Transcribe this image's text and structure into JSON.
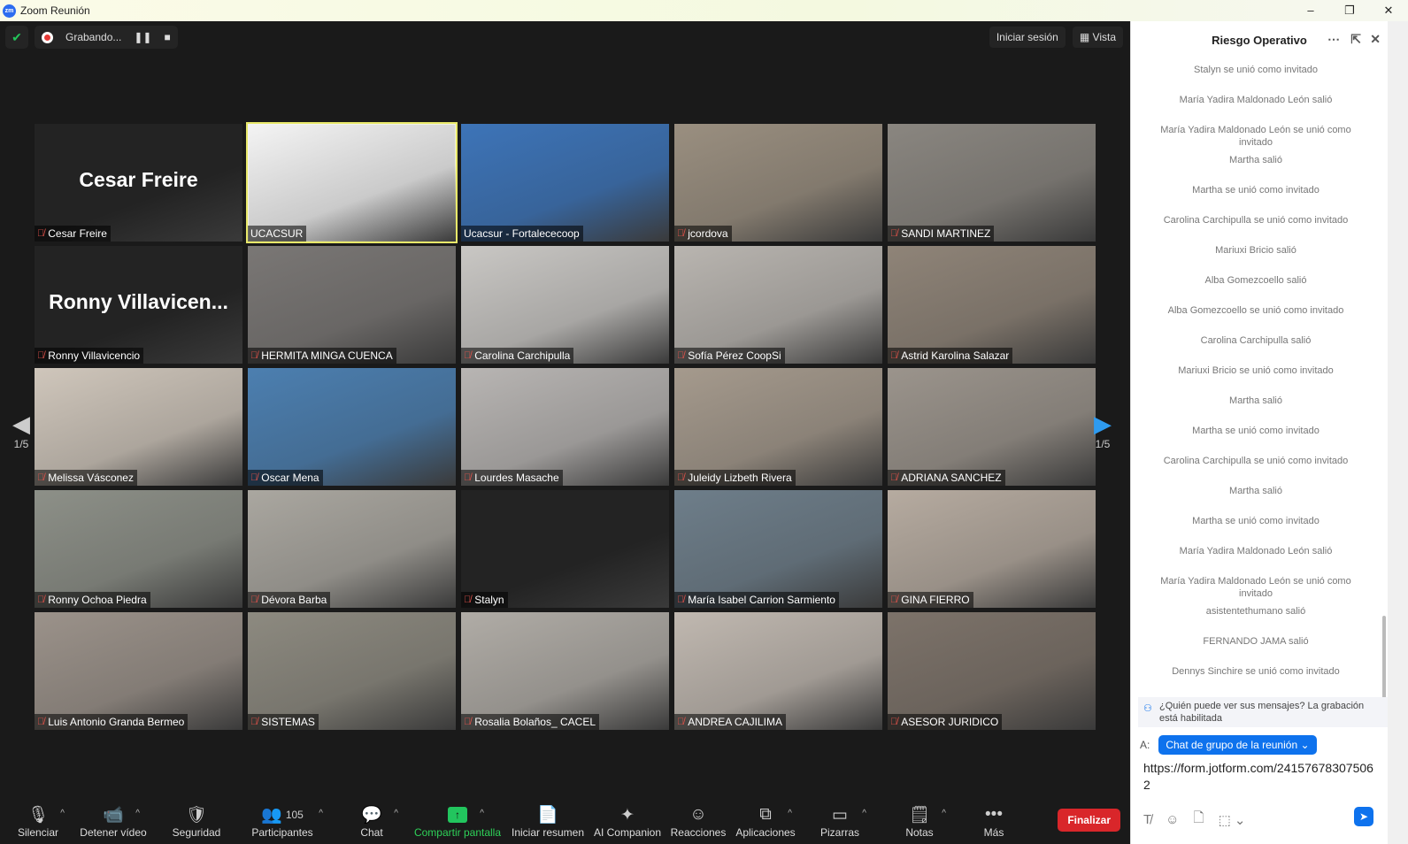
{
  "window": {
    "title": "Zoom Reunión",
    "logo": "zm",
    "controls": [
      "–",
      "❐",
      "✕"
    ]
  },
  "topbar": {
    "recording_label": "Grabando...",
    "signin": "Iniciar sesión",
    "view": "Vista"
  },
  "pager": {
    "page": "1/5"
  },
  "tiles": [
    {
      "name": "Cesar Freire",
      "big": "Cesar Freire",
      "bg": "#232323"
    },
    {
      "name": "UCACSUR",
      "bg": "#f4f4f4",
      "active": true
    },
    {
      "name": "Ucacsur - Fortalececoop",
      "bg": "#3d74b8",
      "muted": false
    },
    {
      "name": "jcordova",
      "bg": "#9a8f80"
    },
    {
      "name": "SANDI MARTINEZ",
      "bg": "#8a8680"
    },
    {
      "name": "Ronny Villavicencio",
      "big": "Ronny  Villavicen...",
      "bg": "#232323"
    },
    {
      "name": "HERMITA MINGA CUENCA",
      "bg": "#7a7775"
    },
    {
      "name": "Carolina Carchipulla",
      "bg": "#c9c7c4"
    },
    {
      "name": "Sofía Pérez CoopSi",
      "bg": "#b9b5b0"
    },
    {
      "name": "Astrid Karolina Salazar",
      "bg": "#8f8478"
    },
    {
      "name": "Melissa Vásconez",
      "bg": "#cfc6bb"
    },
    {
      "name": "Oscar Mena",
      "bg": "#4c7fb0"
    },
    {
      "name": "Lourdes Masache",
      "bg": "#b8b5b3"
    },
    {
      "name": "Juleidy Lizbeth Rivera",
      "bg": "#a59a8d"
    },
    {
      "name": "ADRIANA SANCHEZ",
      "bg": "#9b948c"
    },
    {
      "name": "Ronny Ochoa Piedra",
      "bg": "#8d9088"
    },
    {
      "name": "Dévora Barba",
      "bg": "#aaa7a0"
    },
    {
      "name": "Stalyn",
      "bg": "#232323"
    },
    {
      "name": "María Isabel Carrion Sarmiento",
      "bg": "#6e7e8a"
    },
    {
      "name": "GINA FIERRO",
      "bg": "#b6aba0"
    },
    {
      "name": "Luis Antonio Granda Bermeo",
      "bg": "#9b928a"
    },
    {
      "name": "SISTEMAS",
      "bg": "#8d8a80"
    },
    {
      "name": "Rosalia Bolaños_ CACEL",
      "bg": "#b0aca6"
    },
    {
      "name": "ANDREA CAJILIMA",
      "bg": "#c0b8b0"
    },
    {
      "name": "ASESOR JURIDICO",
      "bg": "#7d736a"
    }
  ],
  "toolbar": [
    {
      "label": "Silenciar",
      "icon": "🎙",
      "caret": true
    },
    {
      "label": "Detener vídeo",
      "icon": "📹",
      "caret": true
    },
    {
      "label": "Seguridad",
      "icon": "🛡"
    },
    {
      "label": "Participantes",
      "icon": "👥",
      "count": "105",
      "caret": true
    },
    {
      "label": "Chat",
      "icon": "💬",
      "caret": true
    },
    {
      "label": "Compartir pantalla",
      "icon": "↑",
      "caret": true,
      "accent": "#2ed158"
    },
    {
      "label": "Iniciar resumen",
      "icon": "📄"
    },
    {
      "label": "AI Companion",
      "icon": "✦"
    },
    {
      "label": "Reacciones",
      "icon": "☺"
    },
    {
      "label": "Aplicaciones",
      "icon": "⧉",
      "caret": true
    },
    {
      "label": "Pizarras",
      "icon": "▭",
      "caret": true
    },
    {
      "label": "Notas",
      "icon": "🗒",
      "caret": true
    },
    {
      "label": "Más",
      "icon": "•••"
    }
  ],
  "end_label": "Finalizar",
  "chat": {
    "title": "Riesgo Operativo",
    "messages": [
      "Stalyn se unió como invitado",
      "María Yadira Maldonado León salió",
      "María Yadira Maldonado León se unió como invitado",
      "Martha salió",
      "Martha se unió como invitado",
      "Carolina Carchipulla se unió como invitado",
      "Mariuxi Bricio salió",
      "Alba Gomezcoello salió",
      "Alba Gomezcoello se unió como invitado",
      "Carolina Carchipulla salió",
      "Mariuxi Bricio se unió como invitado",
      "Martha salió",
      "Martha se unió como invitado",
      "Carolina Carchipulla se unió como invitado",
      "Martha salió",
      "Martha se unió como invitado",
      "María Yadira Maldonado León salió",
      "María Yadira Maldonado León se unió como invitado",
      "asistentethumano salió",
      "FERNANDO JAMA salió",
      "Dennys Sinchire se unió como invitado"
    ],
    "notice": "¿Quién puede ver sus mensajes? La grabación está habilitada",
    "to_label": "A:",
    "recipient": "Chat de grupo de la reunión",
    "input_value": "https://form.jotform.com/241576783075062"
  }
}
